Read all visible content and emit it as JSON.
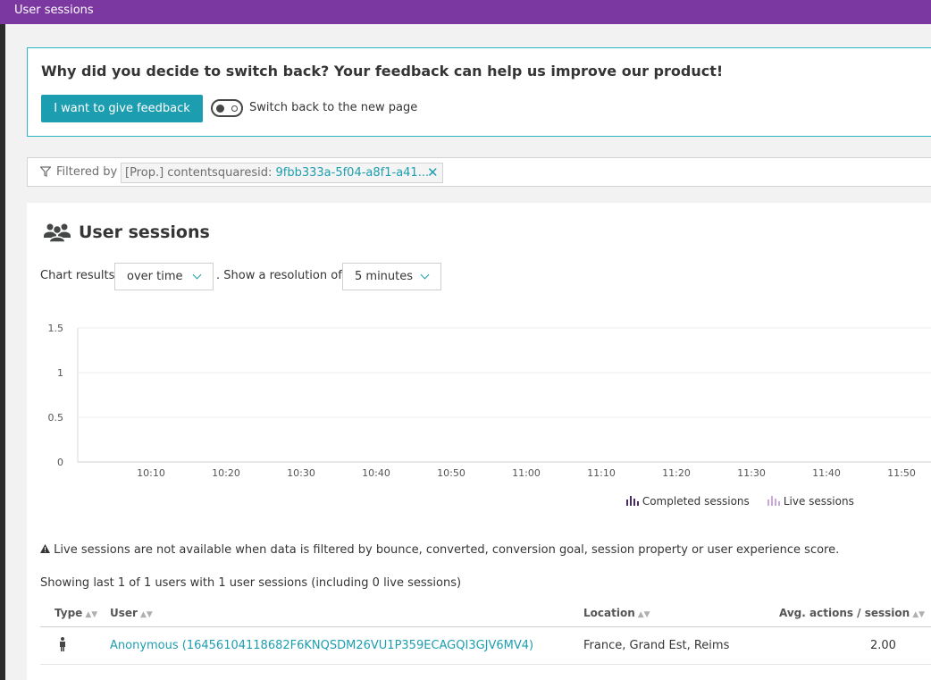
{
  "top_bar": {
    "title": "User sessions"
  },
  "feedback": {
    "question": "Why did you decide to switch back? Your feedback can help us improve our product!",
    "button_label": "I want to give feedback",
    "toggle_label": "Switch back to the new page"
  },
  "filter": {
    "label": "Filtered by",
    "chip_key": "[Prop.] contentsquaresid:",
    "chip_value": "9fbb333a-5f04-a8f1-a41...",
    "close_glyph": "✕"
  },
  "panel": {
    "title": "User sessions",
    "chart_results_label": "Chart results",
    "chart_mode_selected": "over time",
    "resolution_label": ". Show a resolution of",
    "resolution_selected": "5 minutes"
  },
  "chart_data": {
    "type": "bar",
    "title": "",
    "xlabel": "",
    "ylabel": "",
    "ylim": [
      0,
      1.5
    ],
    "y_ticks": [
      "1.5",
      "1",
      "0.5",
      "0"
    ],
    "x_ticks": [
      "10:10",
      "10:20",
      "10:30",
      "10:40",
      "10:50",
      "11:00",
      "11:10",
      "11:20",
      "11:30",
      "11:40",
      "11:50"
    ],
    "series": [
      {
        "name": "Completed sessions",
        "color": "#4b2b6b",
        "values": []
      },
      {
        "name": "Live sessions",
        "color": "#c9a7dc",
        "values": []
      }
    ],
    "grid": true,
    "legend_placement": "bottom-right"
  },
  "notice": {
    "warning_icon": "warning-icon",
    "warning_text": "Live sessions are not available when data is filtered by bounce, converted, conversion goal, session property or user experience score.",
    "showing_text": "Showing last 1 of 1 users with 1 user sessions (including 0 live sessions)"
  },
  "table": {
    "columns": [
      "Type",
      "User",
      "Location",
      "Avg. actions / session"
    ],
    "rows": [
      {
        "type_icon": "person-icon",
        "user": "Anonymous (16456104118682F6KNQSDM26VU1P359ECAGQI3GJV6MV4)",
        "location": "France, Grand Est, Reims",
        "avg_actions": "2.00"
      }
    ]
  },
  "colors": {
    "top_bar": "#7c38a1",
    "accent": "#1d9eb0",
    "completed_sessions": "#4b2b6b",
    "live_sessions": "#c9a7dc"
  }
}
